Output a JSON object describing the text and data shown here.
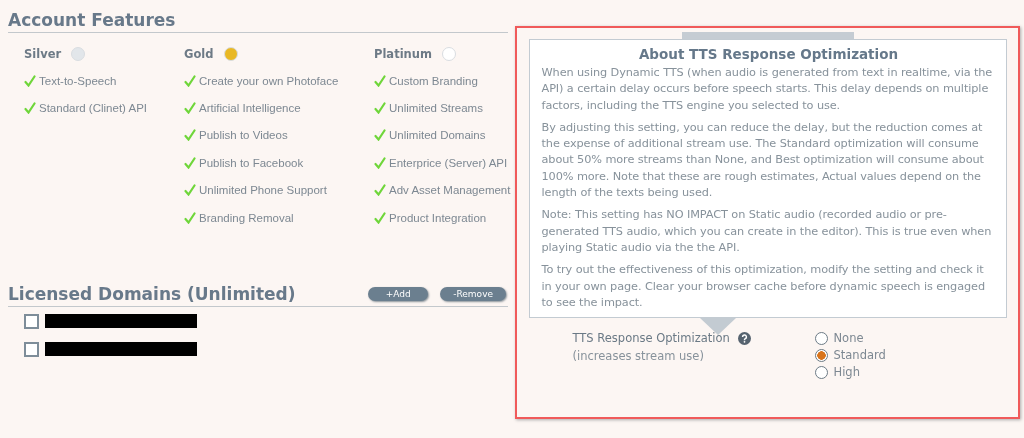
{
  "account_features": {
    "title": "Account Features",
    "tiers": [
      {
        "name": "Silver",
        "color": "#e2e6ea",
        "features": [
          "Text-to-Speech",
          "Standard (Clinet) API"
        ]
      },
      {
        "name": "Gold",
        "color": "#e9b824",
        "features": [
          "Create your own Photoface",
          "Artificial Intelligence",
          "Publish to Videos",
          "Publish to Facebook",
          "Unlimited Phone Support",
          "Branding Removal"
        ]
      },
      {
        "name": "Platinum",
        "color": "#ffffff",
        "features": [
          "Custom Branding",
          "Unlimited Streams",
          "Unlimited Domains",
          "Enterprice (Server) API",
          "Adv Asset Management",
          "Product Integration"
        ]
      }
    ]
  },
  "licensed_domains": {
    "title": "Licensed Domains (Unlimited)",
    "buttons": [
      "+Add",
      "-Remove"
    ],
    "domains": [
      {
        "checked": false
      },
      {
        "checked": false
      }
    ]
  },
  "tooltip": {
    "title": "About TTS Response Optimization",
    "paragraphs": [
      "When using Dynamic TTS (when audio is generated from text in realtime, via the API) a certain delay occurs before speech starts. This delay depends on multiple factors, including the TTS engine you selected to use.",
      "By adjusting this setting, you can reduce the delay, but the reduction comes at the expense of additional stream use. The Standard optimization will consume about 50% more streams than None, and Best optimization will consume about 100% more. Note that these are rough estimates, Actual values depend on the length of the texts being used.",
      "Note: This setting has NO IMPACT on Static audio (recorded audio or pre-generated TTS audio, which you can create in the editor). This is true even when playing Static audio via the the API.",
      "To try out the effectiveness of this optimization, modify the setting and check it in your own page. Clear your browser cache before dynamic speech is engaged to see the impact."
    ]
  },
  "setting": {
    "label": "TTS Response Optimization",
    "sublabel": "(increases stream use)",
    "options": [
      {
        "label": "None",
        "selected": false
      },
      {
        "label": "Standard",
        "selected": true
      },
      {
        "label": "High",
        "selected": false
      }
    ]
  }
}
